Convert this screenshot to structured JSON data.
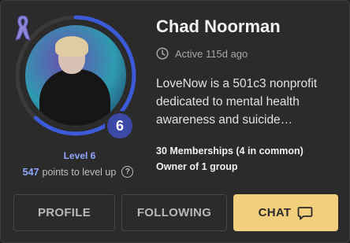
{
  "profile": {
    "name": "Chad Noorman",
    "active": "Active 115d ago",
    "bio": "LoveNow is a 501c3 nonprofit dedicated to mental health awareness and suicide…",
    "memberships": "30 Memberships (4 in common)",
    "owner": "Owner of 1 group",
    "level_number": "6",
    "level_label": "Level 6",
    "points_value": "547",
    "points_text": "points to level up",
    "level_progress_fraction": 0.62
  },
  "buttons": {
    "profile": "PROFILE",
    "following": "FOLLOWING",
    "chat": "CHAT"
  },
  "colors": {
    "accent_blue": "#8fa8ff",
    "ring_blue": "#3b5bdb",
    "chat_yellow": "#f2cf7c",
    "badge_blue": "#3b4aa8"
  },
  "icons": {
    "clock": "clock-icon",
    "help": "help-circle-icon",
    "chat": "chat-bubble-icon",
    "ribbon": "awareness-ribbon-icon"
  }
}
